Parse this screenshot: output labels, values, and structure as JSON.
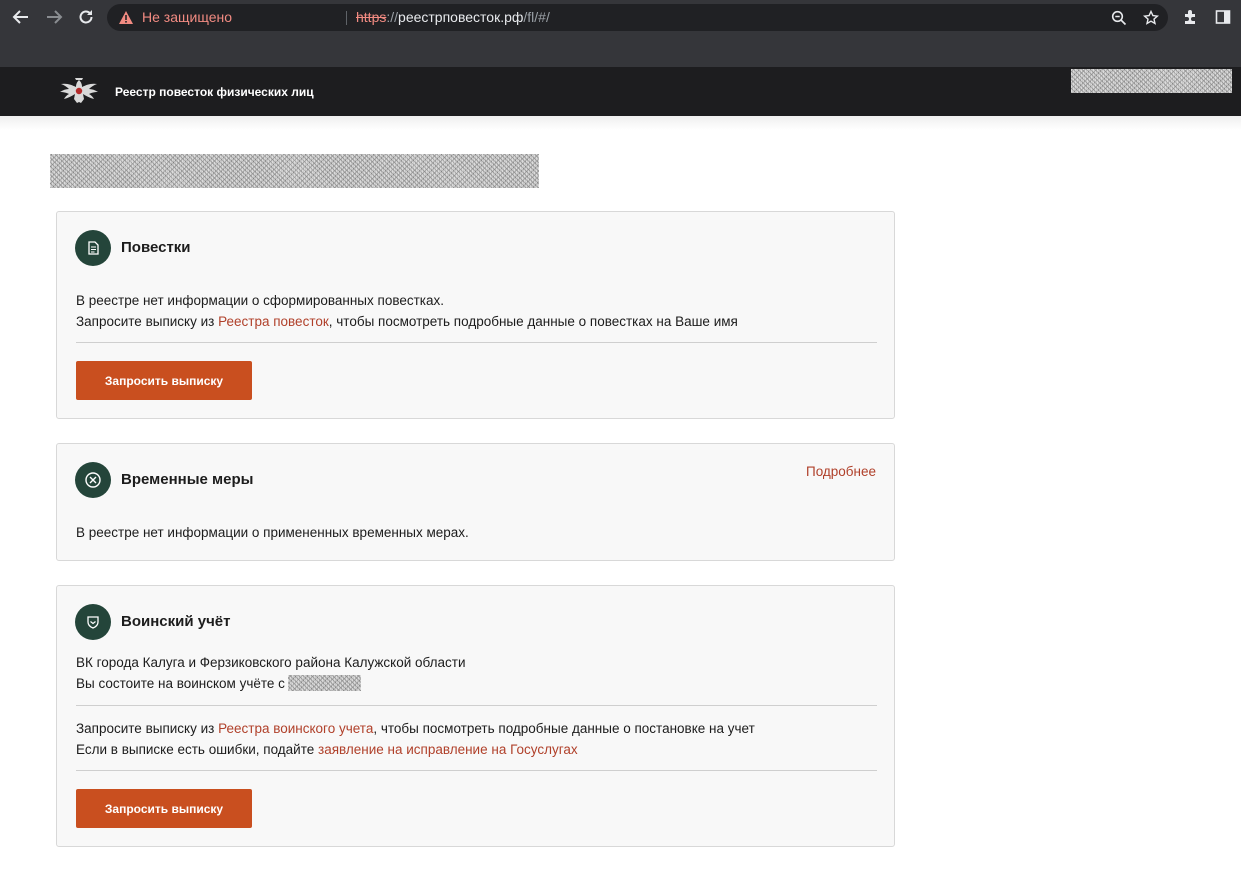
{
  "browser": {
    "security_text": "Не защищено",
    "url_scheme": "https",
    "url_sep": "://",
    "url_host": "реестрповесток.рф",
    "url_path": "/fl/#/"
  },
  "site": {
    "title": "Реестр повесток физических лиц"
  },
  "cards": {
    "summons": {
      "title": "Повестки",
      "line1": "В реестре нет информации о сформированных повестках.",
      "line2_before": "Запросите выписку из ",
      "line2_link": "Реестра повесток",
      "line2_after": ", чтобы посмотреть подробные данные о повестках на Ваше имя",
      "button": "Запросить выписку"
    },
    "measures": {
      "title": "Временные меры",
      "more": "Подробнее",
      "line1": "В реестре нет информации о примененных временных мерах."
    },
    "military": {
      "title": "Воинский учёт",
      "line1": "ВК города Калуга и Ферзиковского района Калужской области",
      "line2": "Вы состоите на воинском учёте с",
      "line3_before": "Запросите выписку из ",
      "line3_link": "Реестра воинского учета",
      "line3_after": ",  чтобы посмотреть подробные данные о постановке на учет",
      "line4_before": "Если в выписке есть ошибки, подайте ",
      "line4_link": "заявление на исправление на Госуслугах",
      "button": "Запросить выписку"
    }
  },
  "colors": {
    "accent": "#c94f1f",
    "link": "#b0402a",
    "icon_bg": "#24453a",
    "header_bg": "#1d1d1f"
  }
}
